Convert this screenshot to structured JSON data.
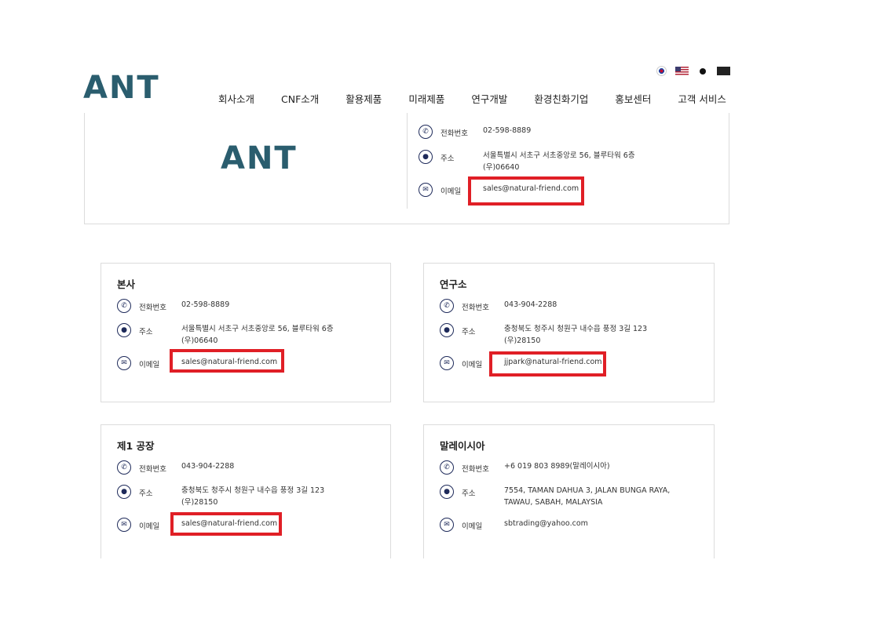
{
  "header": {
    "logo_text": "ANT",
    "nav": [
      "회사소개",
      "CNF소개",
      "활용제품",
      "미래제품",
      "연구개발",
      "환경친화기업",
      "홍보센터",
      "고객 서비스"
    ],
    "languages": [
      "korean-flag-icon",
      "us-flag-icon",
      "japan-flag-icon",
      "china-flag-icon"
    ]
  },
  "top_info": {
    "logo_text": "ANT",
    "phone_label": "전화번호",
    "phone": "02-598-8889",
    "address_label": "주소",
    "address_line1": "서울특별시 서초구 서초중앙로 56, 블루타워 6층",
    "address_line2": "(우)06640",
    "email_label": "이메일",
    "email": "sales@natural-friend.com"
  },
  "cards": [
    {
      "title": "본사",
      "phone_label": "전화번호",
      "phone": "02-598-8889",
      "address_label": "주소",
      "address_line1": "서울특별시 서초구 서초중앙로 56, 블루타워 6층",
      "address_line2": "(우)06640",
      "email_label": "이메일",
      "email": "sales@natural-friend.com"
    },
    {
      "title": "연구소",
      "phone_label": "전화번호",
      "phone": "043-904-2288",
      "address_label": "주소",
      "address_line1": "충청북도 청주시 청원구 내수읍 풍정 3길 123",
      "address_line2": "(우)28150",
      "email_label": "이메일",
      "email": "jjpark@natural-friend.com"
    },
    {
      "title": "제1 공장",
      "phone_label": "전화번호",
      "phone": "043-904-2288",
      "address_label": "주소",
      "address_line1": "충청북도 청주시 청원구 내수읍 풍정 3길 123",
      "address_line2": "(우)28150",
      "email_label": "이메일",
      "email": "sales@natural-friend.com"
    },
    {
      "title": "말레이시아",
      "phone_label": "전화번호",
      "phone": "+6 019 803 8989(말레이시아)",
      "address_label": "주소",
      "address_line1": "7554, TAMAN DAHUA 3, JALAN BUNGA RAYA,",
      "address_line2": "TAWAU, SABAH, MALAYSIA",
      "email_label": "이메일",
      "email": "sbtrading@yahoo.com"
    }
  ],
  "colors": {
    "brand": "#2a5d6e",
    "icon": "#1e2a5a",
    "highlight": "#e01f26",
    "border": "#dcdcdc"
  }
}
